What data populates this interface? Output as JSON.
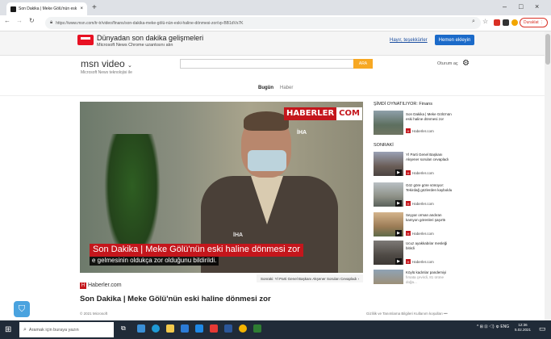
{
  "browser": {
    "tab_title": "Son Dakika | Meke Gölü'nün esk",
    "tab_close": "×",
    "new_tab": "+",
    "window_controls": [
      "–",
      "□",
      "×"
    ],
    "url": "https://www.msn.com/tr-tr/video/finans/son-dakika-meke-gölü-nün-eski-haline-dönmesi-zor/vp-BB1dVs7K",
    "paused_label": "Duraklat"
  },
  "promo": {
    "title": "Dünyadan son dakika gelişmeleri",
    "subtitle": "Microsoft News Chrome uzantısını alın",
    "decline": "Hayır, teşekkürler",
    "add_button": "Hemen ekleyin"
  },
  "header": {
    "logo": "msn video",
    "logo_chevron": "⌄",
    "logo_sub": "Microsoft News teknolojisi ile",
    "search_placeholder": "",
    "search_button": "ARA",
    "signin": "Oturum aç",
    "settings_icon": "gear-icon"
  },
  "subnav": {
    "items": [
      "Bugün",
      "Haber"
    ]
  },
  "video": {
    "brand_red": "HABERLER",
    "brand_white": "COM",
    "watermark": "İHA",
    "watermark2": "İHA",
    "caption_title": "Son Dakika | Meke Gölü'nün eski haline dönmesi zor",
    "caption_sub": "e gelmesinin oldukça zor olduğunu bildirildi.",
    "next_button": "Sonraki: Yİ Parti Genel Başkanı Akşener Soruları Cevapladı  ›"
  },
  "article": {
    "source_letter": "H",
    "source": "Haberler.com",
    "title": "Son Dakika | Meke Gölü'nün eski haline dönmesi zor"
  },
  "sidebar": {
    "now_playing_label": "ŞİMDİ OYNATILIYOR: Finans",
    "now_playing": {
      "title": "Son Dakika | Meke Gölü'nün eski haline dönmesi zor",
      "source": "Haberler.com"
    },
    "next_label": "SONRAKİ",
    "next_items": [
      {
        "title": "Yİ Parti Genel Başkanı Akşener sorulan cevapladı",
        "source": "Haberler.com"
      },
      {
        "title": "Göz göre göre sönüyor: Tekirdağ gözlerden kayboldu",
        "source": "Haberler.com"
      },
      {
        "title": "Seyyar orman andıran kamyon görenleri şaşırttı",
        "source": "Haberler.com"
      },
      {
        "title": "Ucuz ayakkabılar mesleği bitirdi",
        "source": "Haberler.com"
      },
      {
        "title": "Köylü kadınlar pandemiyi",
        "source": "fırsata çevirdi, 81 ürüne doğa..."
      }
    ]
  },
  "footer": {
    "copyright": "© 2021 Microsoft",
    "links": "Gizlilik ve Tanımlama Bilgileri    Kullanım koşulları    •••"
  },
  "taskbar": {
    "search_placeholder": "Aramak için buraya yazın",
    "tray": "^ ⊞ ⊡ ◁) ゅ ENG",
    "time": "12:36",
    "date": "5.02.2021"
  },
  "colors": {
    "msn_orange": "#f7a823",
    "promo_blue": "#1b6ac9",
    "haberler_red": "#c4161c",
    "taskbar": "#202b38"
  }
}
